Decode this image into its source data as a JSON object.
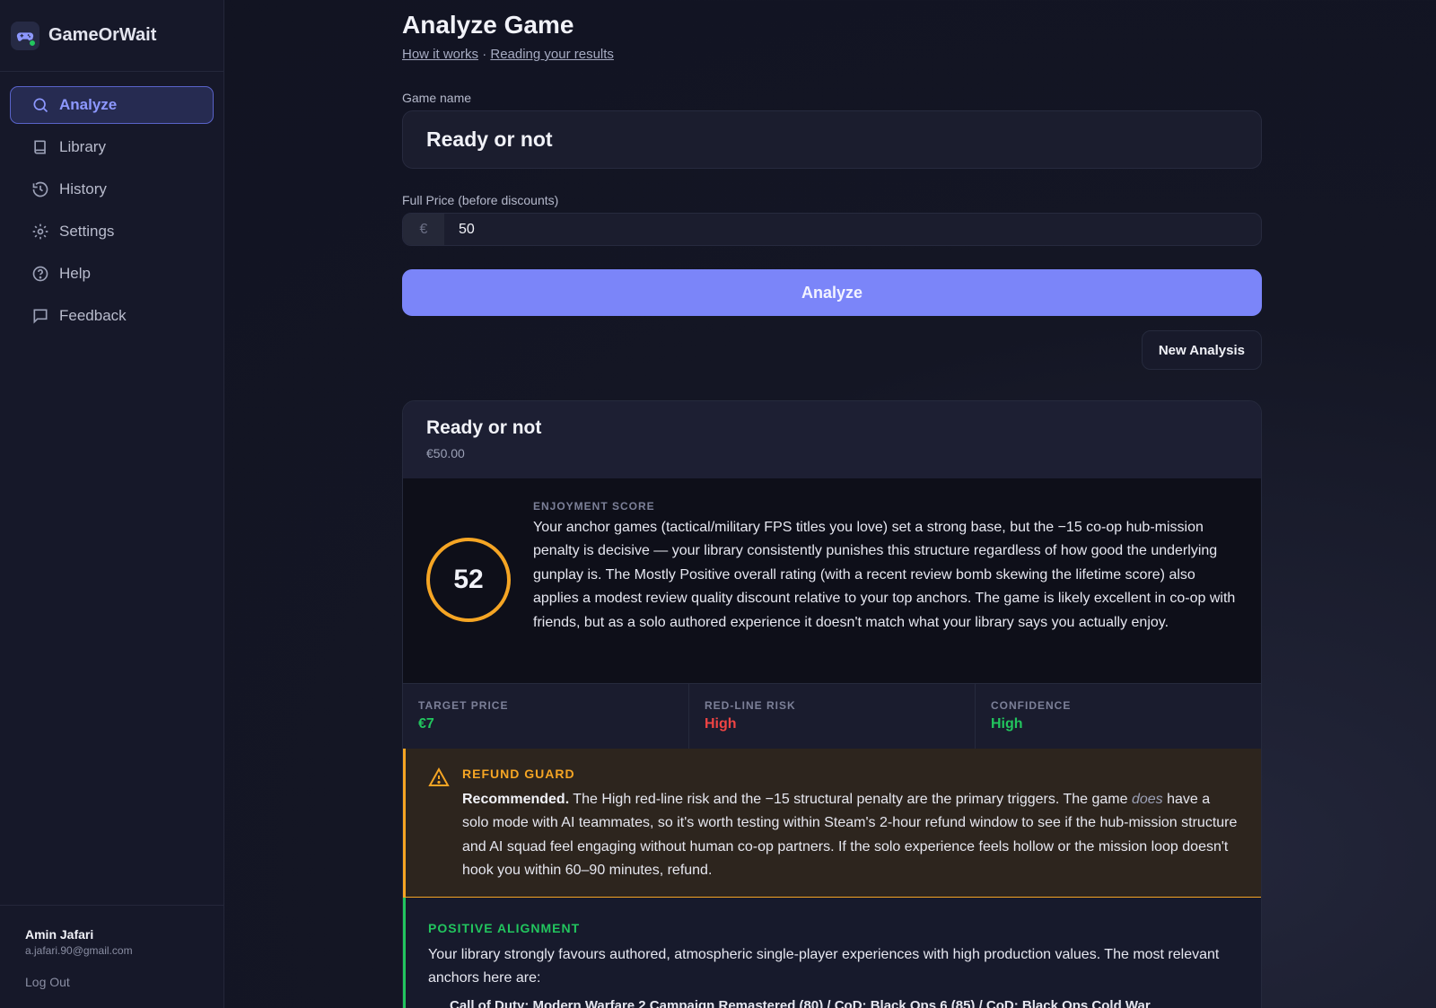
{
  "app": {
    "name": "GameOrWait"
  },
  "sidebar": {
    "items": [
      {
        "label": "Analyze",
        "icon": "search-icon",
        "active": true
      },
      {
        "label": "Library",
        "icon": "book-icon",
        "active": false
      },
      {
        "label": "History",
        "icon": "history-icon",
        "active": false
      },
      {
        "label": "Settings",
        "icon": "gear-icon",
        "active": false
      },
      {
        "label": "Help",
        "icon": "help-circle-icon",
        "active": false
      },
      {
        "label": "Feedback",
        "icon": "message-icon",
        "active": false
      }
    ],
    "user": {
      "name": "Amin Jafari",
      "email": "a.jafari.90@gmail.com",
      "logout": "Log Out"
    }
  },
  "main": {
    "title": "Analyze Game",
    "links": {
      "how_it_works": "How it works",
      "separator": "·",
      "reading_results": "Reading your results"
    },
    "game_field": {
      "label": "Game name",
      "value": "Ready or not"
    },
    "price_field": {
      "label": "Full Price (before discounts)",
      "currency": "€",
      "value": "50"
    },
    "analyze_button": "Analyze",
    "new_analysis_button": "New Analysis"
  },
  "result": {
    "title": "Ready or not",
    "price": "€50.00",
    "score": {
      "label": "ENJOYMENT SCORE",
      "value": "52",
      "description": "Your anchor games (tactical/military FPS titles you love) set a strong base, but the −15 co-op hub-mission penalty is decisive — your library consistently punishes this structure regardless of how good the underlying gunplay is. The Mostly Positive overall rating (with a recent review bomb skewing the lifetime score) also applies a modest review quality discount relative to your top anchors. The game is likely excellent in co-op with friends, but as a solo authored experience it doesn't match what your library says you actually enjoy."
    },
    "metrics": [
      {
        "label": "TARGET PRICE",
        "value": "€7",
        "color": "#22c55e"
      },
      {
        "label": "RED-LINE RISK",
        "value": "High",
        "color": "#ef4444"
      },
      {
        "label": "CONFIDENCE",
        "value": "High",
        "color": "#22c55e"
      }
    ],
    "refund_guard": {
      "title": "REFUND GUARD",
      "lead": "Recommended.",
      "text_before": " The High red-line risk and the −15 structural penalty are the primary triggers. The game ",
      "emphasis": "does",
      "text_after": " have a solo mode with AI teammates, so it's worth testing within Steam's 2-hour refund window to see if the hub-mission structure and AI squad feel engaging without human co-op partners. If the solo experience feels hollow or the mission loop doesn't hook you within 60–90 minutes, refund."
    },
    "positive_alignment": {
      "title": "POSITIVE ALIGNMENT",
      "text": "Your library strongly favours authored, atmospheric single-player experiences with high production values. The most relevant anchors here are:",
      "bullet": "Call of Duty: Modern Warfare 2 Campaign Remastered (80) / CoD: Black Ops 6 (85) / CoD: Black Ops Cold War"
    }
  },
  "colors": {
    "accent": "#7b85f9",
    "warning": "#f5a524",
    "success": "#22c55e",
    "danger": "#ef4444"
  }
}
